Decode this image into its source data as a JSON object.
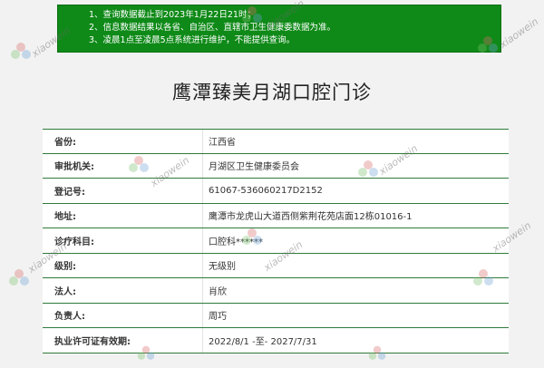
{
  "notice": {
    "lines": [
      "1、查询数据截止到2023年1月22日21时；",
      "2、信息数据结果以各省、自治区、直辖市卫生健康委数据为准。",
      "3、凌晨1点至凌晨5点系统进行维护，不能提供查询。"
    ]
  },
  "title": "鹰潭臻美月湖口腔门诊",
  "rows": [
    {
      "label": "省份:",
      "value": "江西省"
    },
    {
      "label": "审批机关:",
      "value": "月湖区卫生健康委员会"
    },
    {
      "label": "登记号:",
      "value": "61067-536060217D2152"
    },
    {
      "label": "地址:",
      "value": "鹰潭市龙虎山大道西侧紫荆花苑店面12栋01016-1"
    },
    {
      "label": "诊疗科目:",
      "value": "口腔科******"
    },
    {
      "label": "级别:",
      "value": "无级别"
    },
    {
      "label": "法人:",
      "value": "肖欣"
    },
    {
      "label": "负责人:",
      "value": "周巧"
    },
    {
      "label": "执业许可证有效期:",
      "value": "2022/8/1 -至- 2027/7/31"
    }
  ],
  "watermark": {
    "text": "xiaowein",
    "logo_icon": "flower-logo-icon"
  },
  "colors": {
    "notice_bg": "#0f8a18",
    "row_border": "#2f7a3a"
  }
}
